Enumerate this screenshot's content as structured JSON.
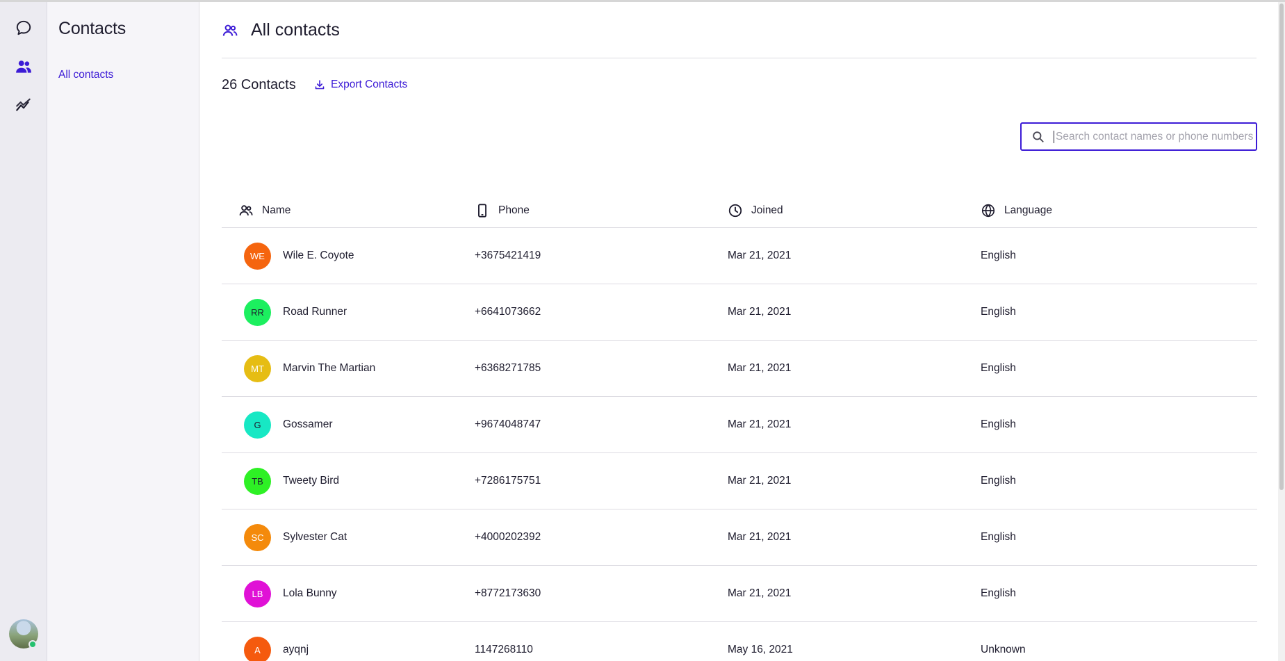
{
  "rail": {
    "items": [
      {
        "name": "chat",
        "icon": "chat-bubble-icon",
        "active": false
      },
      {
        "name": "contacts",
        "icon": "people-icon",
        "active": true
      },
      {
        "name": "analytics",
        "icon": "trend-chart-icon",
        "active": false
      }
    ],
    "profile_icon": "user-avatar",
    "presence_color": "#25c16f"
  },
  "subnav": {
    "title": "Contacts",
    "links": [
      "All contacts"
    ]
  },
  "header": {
    "icon": "people-icon",
    "title": "All contacts"
  },
  "toolbar": {
    "count_label": "26 Contacts",
    "export_label": "Export Contacts",
    "export_icon": "download-icon"
  },
  "search": {
    "placeholder": "Search contact names or phone numbers",
    "value": "",
    "icon": "search-icon"
  },
  "table": {
    "columns": [
      {
        "label": "Name",
        "icon": "people-icon"
      },
      {
        "label": "Phone",
        "icon": "mobile-phone-icon"
      },
      {
        "label": "Joined",
        "icon": "clock-icon"
      },
      {
        "label": "Language",
        "icon": "globe-icon"
      }
    ],
    "rows": [
      {
        "initials": "WE",
        "color": "#f5650f",
        "name": "Wile E. Coyote",
        "phone": "+3675421419",
        "joined": "Mar 21, 2021",
        "language": "English"
      },
      {
        "initials": "RR",
        "color": "#1cef5f",
        "name": "Road Runner",
        "phone": "+6641073662",
        "joined": "Mar 21, 2021",
        "language": "English"
      },
      {
        "initials": "MT",
        "color": "#e6bd14",
        "name": "Marvin The Martian",
        "phone": "+6368271785",
        "joined": "Mar 21, 2021",
        "language": "English"
      },
      {
        "initials": "G",
        "color": "#17e8c4",
        "name": "Gossamer",
        "phone": "+9674048747",
        "joined": "Mar 21, 2021",
        "language": "English"
      },
      {
        "initials": "TB",
        "color": "#2ef025",
        "name": "Tweety Bird",
        "phone": "+7286175751",
        "joined": "Mar 21, 2021",
        "language": "English"
      },
      {
        "initials": "SC",
        "color": "#f48a0b",
        "name": "Sylvester Cat",
        "phone": "+4000202392",
        "joined": "Mar 21, 2021",
        "language": "English"
      },
      {
        "initials": "LB",
        "color": "#e011d6",
        "name": "Lola Bunny",
        "phone": "+8772173630",
        "joined": "Mar 21, 2021",
        "language": "English"
      },
      {
        "initials": "A",
        "color": "#f55a0e",
        "name": "ayqnj",
        "phone": "1147268110",
        "joined": "May 16, 2021",
        "language": "Unknown"
      }
    ]
  },
  "colors": {
    "accent": "#3c1bd6",
    "text": "#1e1c2e",
    "divider": "#dcdbe2"
  }
}
